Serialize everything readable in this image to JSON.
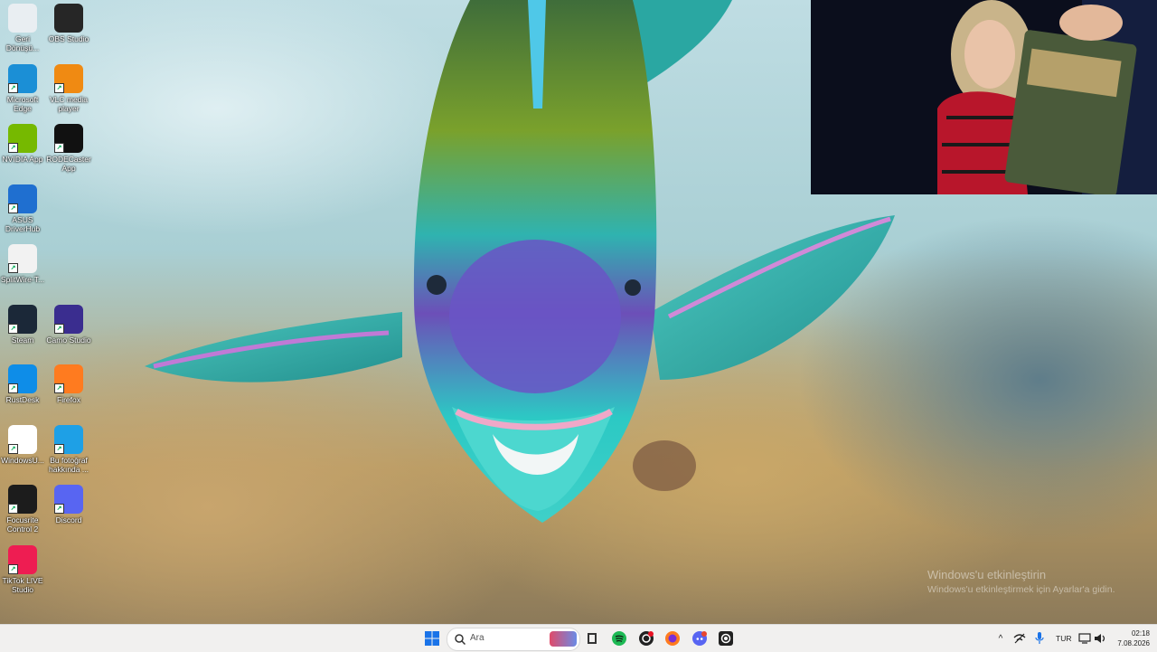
{
  "desktop_icons": [
    {
      "label": "Geri Dönüşü...",
      "icon": "recycle-bin-icon",
      "color": "#e9eef2"
    },
    {
      "label": "OBS Studio",
      "icon": "obs-icon",
      "color": "#262626"
    },
    {
      "label": "Microsoft Edge",
      "icon": "edge-icon",
      "color": "#1b8fd6"
    },
    {
      "label": "VLC media player",
      "icon": "vlc-icon",
      "color": "#f08a12"
    },
    {
      "label": "NVIDIA App",
      "icon": "nvidia-icon",
      "color": "#76b900"
    },
    {
      "label": "RODECaster App",
      "icon": "rodecaster-icon",
      "color": "#111111"
    },
    {
      "label": "ASUS DriverHub",
      "icon": "asus-gear-icon",
      "color": "#1f6fd0"
    },
    {
      "label": "SplitWire-T...",
      "icon": "splitwire-icon",
      "color": "#f2f2f2"
    },
    {
      "label": "Steam",
      "icon": "steam-icon",
      "color": "#1b2838"
    },
    {
      "label": "Camo Studio",
      "icon": "camo-icon",
      "color": "#3a2d8f"
    },
    {
      "label": "RustDesk",
      "icon": "rustdesk-icon",
      "color": "#0e8de8"
    },
    {
      "label": "Firefox",
      "icon": "firefox-icon",
      "color": "#ff7b1f"
    },
    {
      "label": "WindowsU...",
      "icon": "text-file-icon",
      "color": "#ffffff"
    },
    {
      "label": "Bu fotoğraf hakkında ...",
      "icon": "photo-info-icon",
      "color": "#1ea0e6"
    },
    {
      "label": "Focusrite Control 2",
      "icon": "focusrite-icon",
      "color": "#1c1c1c"
    },
    {
      "label": "Discord",
      "icon": "discord-icon",
      "color": "#5865f2"
    },
    {
      "label": "TikTok LIVE Studio",
      "icon": "tiktok-icon",
      "color": "#ee1d52"
    }
  ],
  "watermark": {
    "line1": "Windows'u etkinleştirin",
    "line2": "Windows'u etkinleştirmek için Ayarlar'a gidin."
  },
  "taskbar": {
    "search_placeholder": "Ara",
    "pinned": [
      "start-icon",
      "search-icon",
      "widget-icon",
      "file-explorer-icon",
      "spotify-icon",
      "obs-icon",
      "firefox-icon",
      "discord-icon",
      "camera-app-icon"
    ],
    "language": "TUR",
    "time": "02:18",
    "date": "7.08.2026"
  }
}
